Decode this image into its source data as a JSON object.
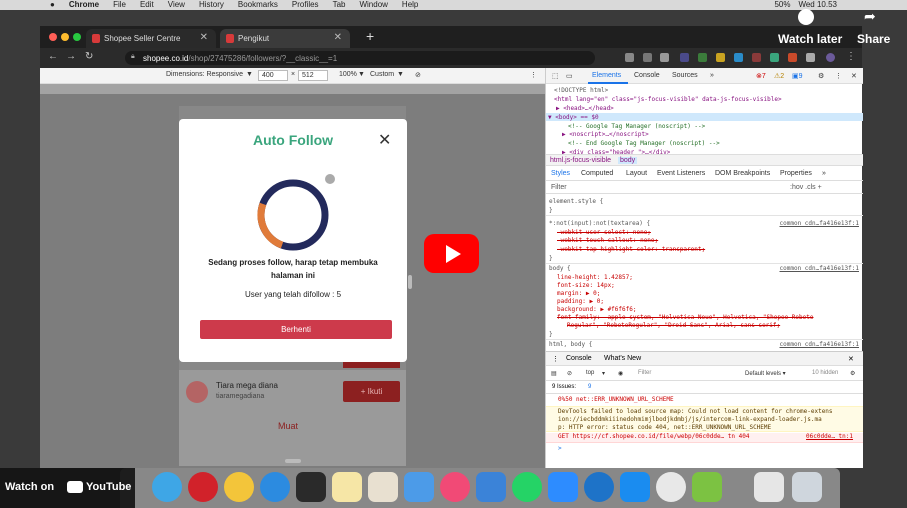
{
  "menubar": {
    "items": [
      "Chrome",
      "File",
      "Edit",
      "View",
      "History",
      "Bookmarks",
      "Profiles",
      "Tab",
      "Window",
      "Help"
    ],
    "battery": "50%",
    "clock": "Wed 10.53"
  },
  "youtube": {
    "watch_later": "Watch later",
    "share": "Share",
    "watch_on": "Watch on",
    "brand": "YouTube",
    "play_color": "#ff0000"
  },
  "browser": {
    "tabs": [
      {
        "label": "Shopee Seller Centre"
      },
      {
        "label": "Pengikut"
      }
    ],
    "url_host": "shopee.co.id",
    "url_path": "/shop/27475286/followers/?__classic__=1"
  },
  "emulation": {
    "dimensions_label": "Dimensions: Responsive",
    "width": "400",
    "height": "512",
    "zoom": "100%",
    "throttle": "Custom"
  },
  "page": {
    "user_name": "Tiara mega diana",
    "user_handle": "tiaramegadiana",
    "follow_label": "+ Ikuti",
    "load_more": "Muat"
  },
  "modal": {
    "title": "Auto Follow",
    "close": "✕",
    "message": "Sedang proses follow, harap tetap membuka halaman ini",
    "count_text": "User yang telah difollow : 5",
    "stop_label": "Berhenti",
    "progress_fraction": 0.25,
    "accent": "#3aa57d",
    "button_color": "#cd3a4b"
  },
  "devtools": {
    "tabs": [
      "Elements",
      "Console",
      "Sources"
    ],
    "more": "»",
    "badges": {
      "errors": "7",
      "warnings": "2",
      "info": "9"
    },
    "dom_lines": [
      "<!DOCTYPE html>",
      "<html lang=\"en\" class=\"js-focus-visible\" data-js-focus-visible>",
      "▶ <head>…</head>",
      "▼ <body> == $0",
      "<!-- Google Tag Manager (noscript) -->",
      "▶ <noscript>…</noscript>",
      "<!-- End Google Tag Manager (noscript) -->",
      "▶ <div class=\"header \">…</div>"
    ],
    "breadcrumbs": [
      "html.js-focus-visible",
      "body"
    ],
    "style_tabs": [
      "Styles",
      "Computed",
      "Layout",
      "Event Listeners",
      "DOM Breakpoints",
      "Properties",
      "»"
    ],
    "filter_placeholder": "Filter",
    "filter_tools": ":hov  .cls  +",
    "style_rules": [
      "element.style {",
      "}",
      "*:not(input):not(textarea) {",
      "-webkit-user-select: none;",
      "-webkit-touch-callout: none;",
      "-webkit-tap-highlight-color: transparent;",
      "}",
      "body {",
      "line-height: 1.42857;",
      "font-size: 14px;",
      "margin: ▶ 0;",
      "padding: ▶ 0;",
      "background: ▶ #f6f6f6;",
      "font-family: -apple-system, \"Helvetica Neue\", Helvetica, \"Shopee Roboto",
      "Regular\", \"RobotoRegular\", \"Droid Sans\", Arial, sans-serif;",
      "}",
      "html, body {",
      "overflow-x: hidden;"
    ],
    "source_link": "common_cdn…fa416e13f:1",
    "drawer_tabs": [
      "Console",
      "What's New"
    ],
    "context": "top",
    "console_filter": "Filter",
    "levels": "Default levels ▾",
    "hidden": "10 hidden",
    "issues": "9 Issues: ",
    "issues_count": "9",
    "console_lines": [
      "0%50 net::ERR_UNKNOWN_URL_SCHEME",
      "DevTools failed to load source map: Could not load content for chrome-extens",
      "ion://iecbddmkiiinedohmimjlbodjkdmbj/js/intercom-link-expand-loader.js.ma",
      "p: HTTP error: status code 404, net::ERR_UNKNOWN_URL_SCHEME",
      "GET https://cf.shopee.co.id/file/webp/06c0dde… tn 404",
      "06c0dde… tn:1",
      ">"
    ]
  }
}
